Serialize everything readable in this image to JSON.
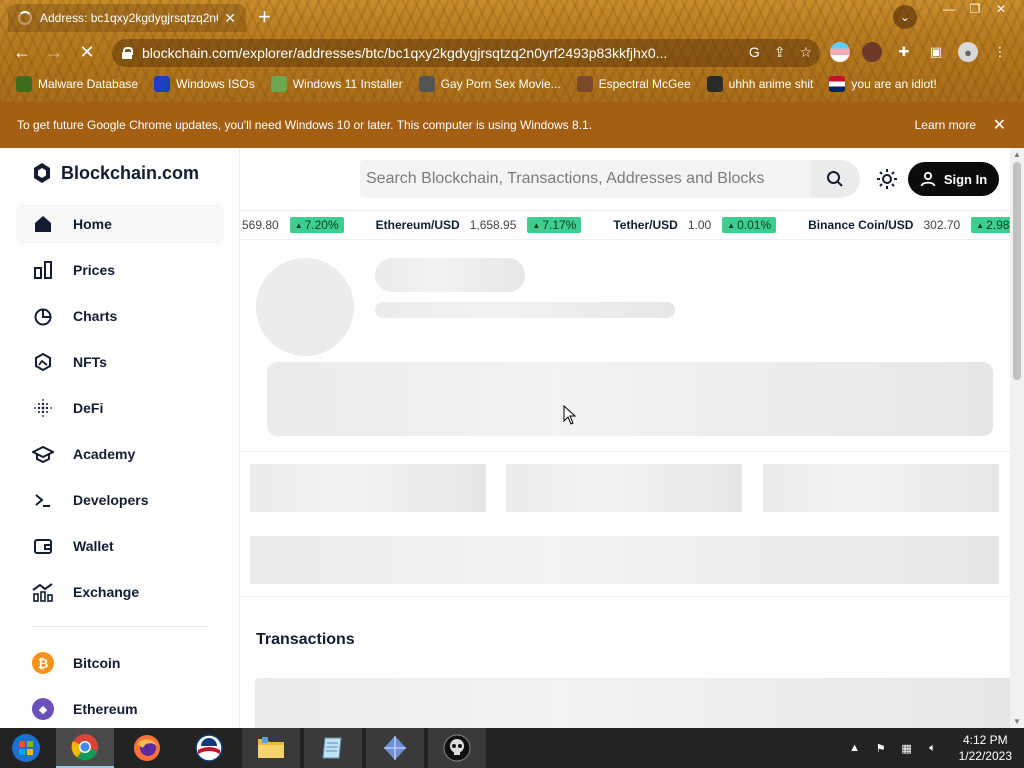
{
  "browser": {
    "tab_title": "Address: bc1qxy2kgdygjrsqtzq2n0",
    "url": "blockchain.com/explorer/addresses/btc/bc1qxy2kgdygjrsqtzq2n0yrf2493p83kkfjhx0...",
    "bookmarks": [
      {
        "label": "Malware Database",
        "icon": "malware-bookmark-icon",
        "color": "#3f6b1e"
      },
      {
        "label": "Windows ISOs",
        "icon": "x-bookmark-icon",
        "color": "#1a3fbf"
      },
      {
        "label": "Windows 11 Installer",
        "icon": "installer-bookmark-icon",
        "color": "#6aa84f"
      },
      {
        "label": "Gay Porn Sex Movie...",
        "icon": "gear-face-bookmark-icon",
        "color": "#555555"
      },
      {
        "label": "Espectral McGee",
        "icon": "ghost-bookmark-icon",
        "color": "#7a4a2a"
      },
      {
        "label": "uhhh anime shit",
        "icon": "anime-bookmark-icon",
        "color": "#2b2b2b"
      },
      {
        "label": "you are an idiot!",
        "icon": "flag-bookmark-icon",
        "color": "#c8102e"
      }
    ]
  },
  "infobar": {
    "message": "To get future Google Chrome updates, you'll need Windows 10 or later. This computer is using Windows 8.1.",
    "learn_more": "Learn more"
  },
  "sidebar": {
    "brand": "Blockchain.com",
    "items": [
      {
        "label": "Home",
        "icon": "home-icon",
        "active": true
      },
      {
        "label": "Prices",
        "icon": "prices-icon"
      },
      {
        "label": "Charts",
        "icon": "charts-icon"
      },
      {
        "label": "NFTs",
        "icon": "nfts-icon"
      },
      {
        "label": "DeFi",
        "icon": "defi-icon"
      },
      {
        "label": "Academy",
        "icon": "academy-icon"
      },
      {
        "label": "Developers",
        "icon": "developers-icon"
      },
      {
        "label": "Wallet",
        "icon": "wallet-icon"
      },
      {
        "label": "Exchange",
        "icon": "exchange-icon"
      }
    ],
    "coins": [
      {
        "label": "Bitcoin",
        "icon": "bitcoin-icon",
        "color": "#f7931a",
        "glyph": "₿"
      },
      {
        "label": "Ethereum",
        "icon": "ethereum-icon",
        "color": "#6b4fbb",
        "glyph": "◆"
      }
    ]
  },
  "header": {
    "search_placeholder": "Search Blockchain, Transactions, Addresses and Blocks",
    "signin_label": "Sign In"
  },
  "ticker": [
    {
      "name": "",
      "price": "569.80",
      "change": "7.20%"
    },
    {
      "name": "Ethereum/USD",
      "price": "1,658.95",
      "change": "7.17%"
    },
    {
      "name": "Tether/USD",
      "price": "1.00",
      "change": "0.01%"
    },
    {
      "name": "Binance Coin/USD",
      "price": "302.70",
      "change": "2.98%"
    }
  ],
  "main": {
    "transactions_heading": "Transactions"
  },
  "taskbar": {
    "apps": [
      "start-orb",
      "chrome",
      "firefox",
      "obama-badge",
      "file-explorer",
      "notepad",
      "gem-app",
      "skull-app"
    ],
    "time": "4:12 PM",
    "date": "1/22/2023"
  },
  "colors": {
    "accent_positive": "#3ecf8e",
    "brand_dark": "#121d33",
    "infobar": "#a45f13"
  }
}
